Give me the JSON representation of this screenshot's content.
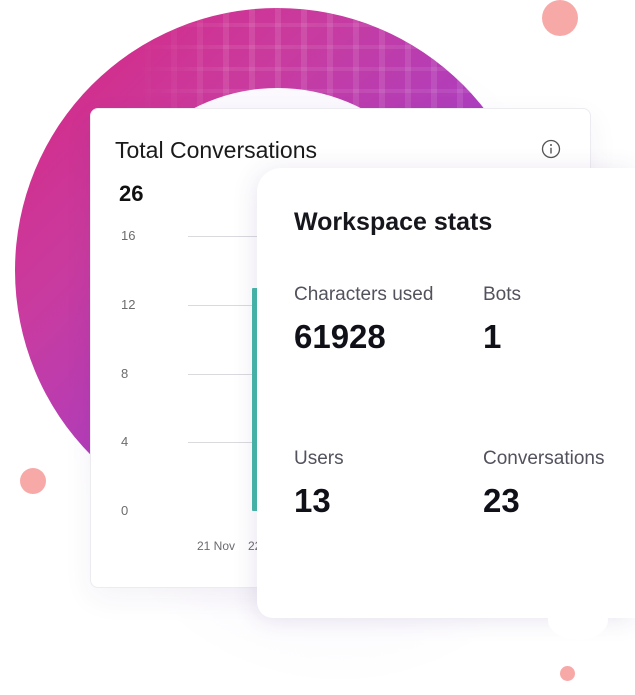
{
  "conversations_card": {
    "title": "Total Conversations",
    "total": "26",
    "info_icon": "info-circle-icon"
  },
  "chart_data": {
    "type": "bar",
    "title": "Total Conversations",
    "categories": [
      "21 Nov",
      "22"
    ],
    "y_ticks": [
      "16",
      "12",
      "8",
      "4",
      "0"
    ],
    "ylim": [
      0,
      16
    ],
    "series": [
      {
        "values": [
          0,
          13
        ]
      }
    ],
    "bar_color": "#45b9a9",
    "grid": true
  },
  "stats_card": {
    "title": "Workspace stats",
    "stats": [
      {
        "label": "Characters used",
        "value": "61928"
      },
      {
        "label": "Bots",
        "value": "1"
      },
      {
        "label": "Users",
        "value": "13"
      },
      {
        "label": "Conversations",
        "value": "23"
      }
    ]
  },
  "colors": {
    "ring_start": "#d8267f",
    "ring_end": "#7a33d1",
    "accent_dot": "#f7a9a8"
  }
}
